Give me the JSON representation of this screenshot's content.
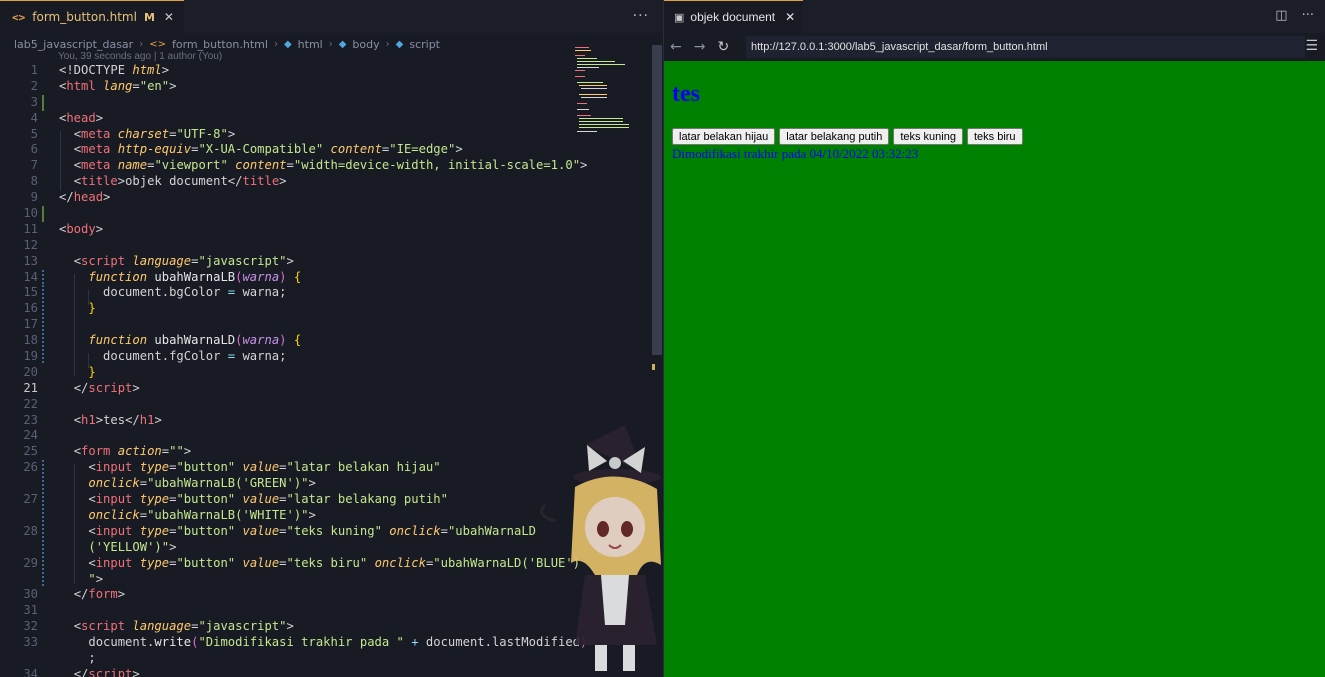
{
  "editor": {
    "tab": {
      "icon": "<>",
      "filename": "form_button.html",
      "status": "M"
    },
    "tab_actions": "···",
    "breadcrumb": [
      "lab5_javascript_dasar",
      "form_button.html",
      "html",
      "body",
      "script"
    ],
    "codelens": "You, 39 seconds ago | 1 author (You)",
    "lines": [
      {
        "n": "1",
        "html": "<span class='t-br'>&lt;!DOCTYPE </span><span class='t-attr'>html</span><span class='t-br'>&gt;</span>",
        "g": ""
      },
      {
        "n": "2",
        "html": "<span class='t-br'>&lt;</span><span class='t-tag'>html</span> <span class='t-attr'>lang</span><span class='t-br'>=</span><span class='t-str'>\"en\"</span><span class='t-br'>&gt;</span>",
        "g": ""
      },
      {
        "n": "3",
        "html": "",
        "g": "add"
      },
      {
        "n": "4",
        "html": "<span class='t-br'>&lt;</span><span class='t-tag'>head</span><span class='t-br'>&gt;</span>",
        "g": ""
      },
      {
        "n": "5",
        "html": "  <span class='t-br'>&lt;</span><span class='t-tag'>meta</span> <span class='t-attr'>charset</span><span class='t-br'>=</span><span class='t-str'>\"UTF-8\"</span><span class='t-br'>&gt;</span>",
        "g": ""
      },
      {
        "n": "6",
        "html": "  <span class='t-br'>&lt;</span><span class='t-tag'>meta</span> <span class='t-attr'>http-equiv</span><span class='t-br'>=</span><span class='t-str'>\"X-UA-Compatible\"</span> <span class='t-attr'>content</span><span class='t-br'>=</span><span class='t-str'>\"IE=edge\"</span><span class='t-br'>&gt;</span>",
        "g": ""
      },
      {
        "n": "7",
        "html": "  <span class='t-br'>&lt;</span><span class='t-tag'>meta</span> <span class='t-attr'>name</span><span class='t-br'>=</span><span class='t-str'>\"viewport\"</span> <span class='t-attr'>content</span><span class='t-br'>=</span><span class='t-str'>\"width=device-width, initial-scale=1.0\"</span><span class='t-br'>&gt;</span>",
        "g": ""
      },
      {
        "n": "8",
        "html": "  <span class='t-br'>&lt;</span><span class='t-tag'>title</span><span class='t-br'>&gt;</span><span class='t-plain'>objek document</span><span class='t-br'>&lt;/</span><span class='t-tag'>title</span><span class='t-br'>&gt;</span>",
        "g": ""
      },
      {
        "n": "9",
        "html": "<span class='t-br'>&lt;/</span><span class='t-tag'>head</span><span class='t-br'>&gt;</span>",
        "g": ""
      },
      {
        "n": "10",
        "html": "",
        "g": "add"
      },
      {
        "n": "11",
        "html": "<span class='t-br'>&lt;</span><span class='t-tag'>body</span><span class='t-br'>&gt;</span>",
        "g": ""
      },
      {
        "n": "12",
        "html": "",
        "g": ""
      },
      {
        "n": "13",
        "html": "  <span class='t-br'>&lt;</span><span class='t-tag'>script</span> <span class='t-attr'>language</span><span class='t-br'>=</span><span class='t-str'>\"javascript\"</span><span class='t-br'>&gt;</span>",
        "g": ""
      },
      {
        "n": "14",
        "html": "    <span class='t-kw'>function</span> <span class='t-fn'>ubahWarnaLB</span><span class='t-paren'>(</span><span class='t-param'>warna</span><span class='t-paren'>)</span> <span class='t-brace'>{</span>",
        "g": "mod"
      },
      {
        "n": "15",
        "html": "      <span class='t-plain'>document.bgColor </span><span class='t-punc'>=</span><span class='t-plain'> warna;</span>",
        "g": "mod"
      },
      {
        "n": "16",
        "html": "    <span class='t-brace'>}</span>",
        "g": "mod"
      },
      {
        "n": "17",
        "html": "",
        "g": "mod"
      },
      {
        "n": "18",
        "html": "    <span class='t-kw'>function</span> <span class='t-fn'>ubahWarnaLD</span><span class='t-paren'>(</span><span class='t-param'>warna</span><span class='t-paren'>)</span> <span class='t-brace'>{</span>",
        "g": "mod"
      },
      {
        "n": "19",
        "html": "      <span class='t-plain'>document.fgColor </span><span class='t-punc'>=</span><span class='t-plain'> warna;</span>",
        "g": "mod"
      },
      {
        "n": "20",
        "html": "    <span class='t-brace'>}</span>",
        "g": ""
      },
      {
        "n": "21",
        "html": "  <span class='t-br'>&lt;/</span><span class='t-tag'>script</span><span class='t-br'>&gt;</span>",
        "g": "",
        "active": true
      },
      {
        "n": "22",
        "html": "",
        "g": ""
      },
      {
        "n": "23",
        "html": "  <span class='t-br'>&lt;</span><span class='t-tag'>h1</span><span class='t-br'>&gt;</span><span class='t-plain'>tes</span><span class='t-br'>&lt;/</span><span class='t-tag'>h1</span><span class='t-br'>&gt;</span>",
        "g": ""
      },
      {
        "n": "24",
        "html": "",
        "g": ""
      },
      {
        "n": "25",
        "html": "  <span class='t-br'>&lt;</span><span class='t-tag'>form</span> <span class='t-attr'>action</span><span class='t-br'>=</span><span class='t-str'>\"\"</span><span class='t-br'>&gt;</span>",
        "g": ""
      },
      {
        "n": "26",
        "html": "    <span class='t-br'>&lt;</span><span class='t-tag'>input</span> <span class='t-attr'>type</span><span class='t-br'>=</span><span class='t-str'>\"button\"</span> <span class='t-attr'>value</span><span class='t-br'>=</span><span class='t-str'>\"latar belakan hijau\"</span>",
        "g": "mod"
      },
      {
        "n": "",
        "html": "    <span class='t-attr'>onclick</span><span class='t-br'>=</span><span class='t-str'>\"ubahWarnaLB(</span><span class='t-str'>'GREEN'</span><span class='t-str'>)\"</span><span class='t-br'>&gt;</span>",
        "g": "mod"
      },
      {
        "n": "27",
        "html": "    <span class='t-br'>&lt;</span><span class='t-tag'>input</span> <span class='t-attr'>type</span><span class='t-br'>=</span><span class='t-str'>\"button\"</span> <span class='t-attr'>value</span><span class='t-br'>=</span><span class='t-str'>\"latar belakang putih\"</span>",
        "g": "mod"
      },
      {
        "n": "",
        "html": "    <span class='t-attr'>onclick</span><span class='t-br'>=</span><span class='t-str'>\"ubahWarnaLB(</span><span class='t-str'>'WHITE'</span><span class='t-str'>)\"</span><span class='t-br'>&gt;</span>",
        "g": "mod"
      },
      {
        "n": "28",
        "html": "    <span class='t-br'>&lt;</span><span class='t-tag'>input</span> <span class='t-attr'>type</span><span class='t-br'>=</span><span class='t-str'>\"button\"</span> <span class='t-attr'>value</span><span class='t-br'>=</span><span class='t-str'>\"teks kuning\"</span> <span class='t-attr'>onclick</span><span class='t-br'>=</span><span class='t-str'>\"ubahWarnaLD</span>",
        "g": "mod"
      },
      {
        "n": "",
        "html": "    <span class='t-str'>(</span><span class='t-str'>'YELLOW'</span><span class='t-str'>)\"</span><span class='t-br'>&gt;</span>",
        "g": "mod"
      },
      {
        "n": "29",
        "html": "    <span class='t-br'>&lt;</span><span class='t-tag'>input</span> <span class='t-attr'>type</span><span class='t-br'>=</span><span class='t-str'>\"button\"</span> <span class='t-attr'>value</span><span class='t-br'>=</span><span class='t-str'>\"teks biru\"</span> <span class='t-attr'>onclick</span><span class='t-br'>=</span><span class='t-str'>\"ubahWarnaLD(</span><span class='t-str'>'BLUE'</span><span class='t-str'>)</span>",
        "g": "mod"
      },
      {
        "n": "",
        "html": "    <span class='t-str'>\"</span><span class='t-br'>&gt;</span>",
        "g": "mod"
      },
      {
        "n": "30",
        "html": "  <span class='t-br'>&lt;/</span><span class='t-tag'>form</span><span class='t-br'>&gt;</span>",
        "g": ""
      },
      {
        "n": "31",
        "html": "",
        "g": ""
      },
      {
        "n": "32",
        "html": "  <span class='t-br'>&lt;</span><span class='t-tag'>script</span> <span class='t-attr'>language</span><span class='t-br'>=</span><span class='t-str'>\"javascript\"</span><span class='t-br'>&gt;</span>",
        "g": ""
      },
      {
        "n": "33",
        "html": "    <span class='t-plain'>document.</span><span class='t-fn'>write</span><span class='t-paren'>(</span><span class='t-str'>\"Dimodifikasi trakhir pada \"</span> <span class='t-punc'>+</span> <span class='t-plain'>document.lastModified</span><span class='t-paren'>)</span>",
        "g": ""
      },
      {
        "n": "",
        "html": "    <span class='t-plain'>;</span>",
        "g": ""
      },
      {
        "n": "34",
        "html": "  <span class='t-br'>&lt;/</span><span class='t-tag'>script</span><span class='t-br'>&gt;</span>",
        "g": ""
      }
    ]
  },
  "browser": {
    "tab_title": "objek document",
    "url": "http://127.0.0.1:3000/lab5_javascript_dasar/form_button.html",
    "page": {
      "heading": "tes",
      "buttons": [
        "latar belakan hijau",
        "latar belakang putih",
        "teks kuning",
        "teks biru"
      ],
      "modified_text": "Dimodifikasi trakhir pada 04/10/2022 03:32:23"
    }
  }
}
